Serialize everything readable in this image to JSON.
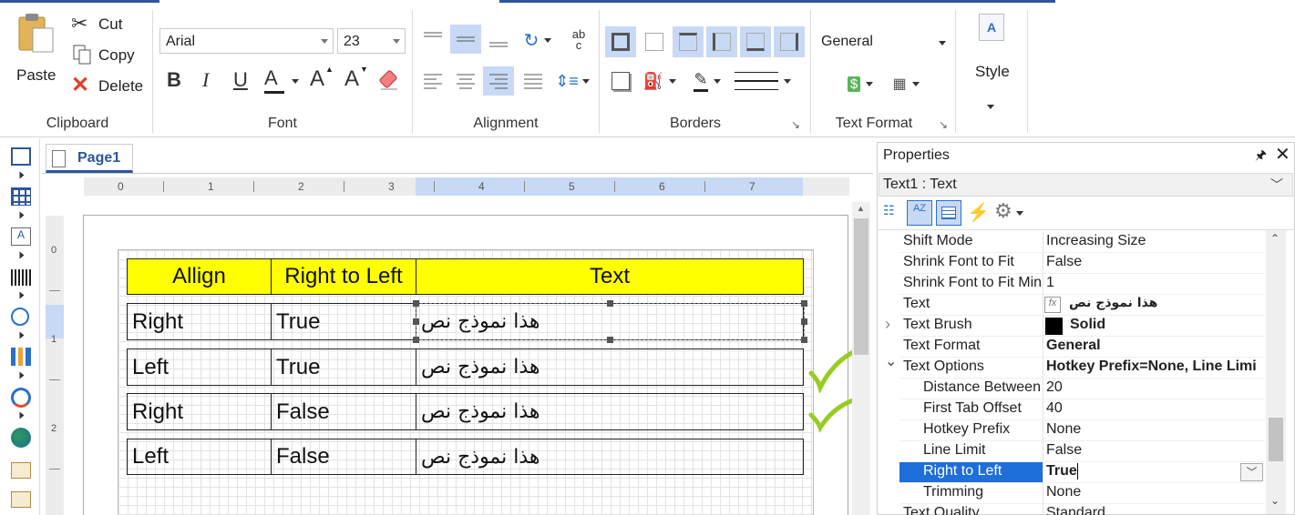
{
  "ribbon": {
    "clipboard": {
      "label": "Clipboard",
      "paste": "Paste",
      "cut": "Cut",
      "copy": "Copy",
      "delete": "Delete"
    },
    "font": {
      "label": "Font",
      "family": "Arial",
      "size": "23",
      "bold": "B",
      "italic": "I",
      "underline": "U",
      "font_color_glyph": "A",
      "grow_glyph": "A",
      "shrink_glyph": "A"
    },
    "alignment": {
      "label": "Alignment",
      "rotate_glyph": "ab c"
    },
    "borders": {
      "label": "Borders"
    },
    "text_format": {
      "label": "Text Format",
      "format_value": "General"
    },
    "style": {
      "label": "Style"
    }
  },
  "designer": {
    "tab_label": "Page1",
    "ruler_h": [
      "0",
      "1",
      "2",
      "3",
      "4",
      "5",
      "6",
      "7"
    ],
    "ruler_v": [
      "0",
      "1",
      "2"
    ],
    "table": {
      "headers": [
        "Allign",
        "Right to Left",
        "Text"
      ],
      "rows": [
        [
          "Right",
          "True",
          "هذا نموذج نص"
        ],
        [
          "Left",
          "True",
          "هذا نموذج نص"
        ],
        [
          "Right",
          "False",
          "هذا نموذج نص"
        ],
        [
          "Left",
          "False",
          "هذا نموذج نص"
        ]
      ]
    }
  },
  "properties": {
    "title": "Properties",
    "selector": "Text1 : Text",
    "rows": [
      {
        "name": "Shift Mode",
        "value": "Increasing Size"
      },
      {
        "name": "Shrink Font to Fit",
        "value": "False"
      },
      {
        "name": "Shrink Font to Fit Min",
        "value": "1"
      },
      {
        "name": "Text",
        "value": "هذا نموذج نص"
      },
      {
        "name": "Text Brush",
        "value": "Solid"
      },
      {
        "name": "Text Format",
        "value": "General"
      },
      {
        "name": "Text Options",
        "value": "Hotkey Prefix=None, Line Limi"
      },
      {
        "name": "Distance Between",
        "value": "20"
      },
      {
        "name": "First Tab Offset",
        "value": "40"
      },
      {
        "name": "Hotkey Prefix",
        "value": "None"
      },
      {
        "name": "Line Limit",
        "value": "False"
      },
      {
        "name": "Right to Left",
        "value": "True"
      },
      {
        "name": "Trimming",
        "value": "None"
      },
      {
        "name": "Text Quality",
        "value": "Standard"
      }
    ]
  },
  "colors": {
    "accent": "#2b579a",
    "selection": "#c7d9f5",
    "header_fill": "#ffff00",
    "checkmark": "#99cc22",
    "prop_selected": "#1e6fd9"
  }
}
